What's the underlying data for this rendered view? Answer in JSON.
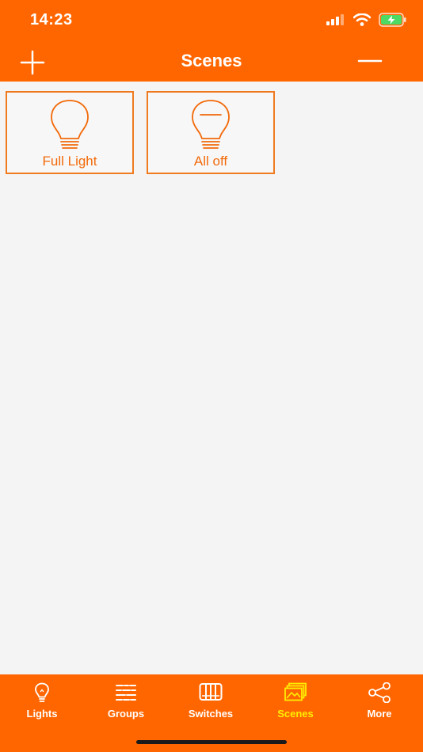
{
  "status_bar": {
    "time": "14:23"
  },
  "nav": {
    "title": "Scenes"
  },
  "scenes": [
    {
      "label": "Full Light",
      "icon": "lightbulb-on-icon"
    },
    {
      "label": "All off",
      "icon": "lightbulb-off-icon"
    }
  ],
  "tabs": [
    {
      "label": "Lights",
      "icon": "lightbulb-icon",
      "active": false
    },
    {
      "label": "Groups",
      "icon": "groups-icon",
      "active": false
    },
    {
      "label": "Switches",
      "icon": "switches-icon",
      "active": false
    },
    {
      "label": "Scenes",
      "icon": "scenes-icon",
      "active": true
    },
    {
      "label": "More",
      "icon": "share-icon",
      "active": false
    }
  ],
  "colors": {
    "brand": "#ff6600",
    "tile_text": "#f26a0a",
    "active_tab": "#ffee00",
    "background": "#f4f4f4"
  }
}
